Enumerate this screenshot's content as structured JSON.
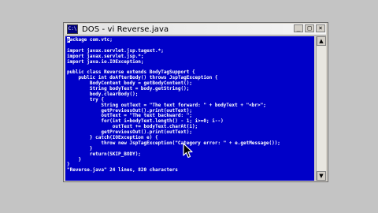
{
  "window": {
    "title": "DOS - vi Reverse.java",
    "icon_text": "C:\\",
    "minimize_label": "_",
    "maximize_label": "□",
    "close_label": "×"
  },
  "editor": {
    "lines": [
      "package com.vtc;",
      "",
      "import javax.servlet.jsp.tagext.*;",
      "import javax.servlet.jsp.*;",
      "import java.io.IOException;",
      "",
      "public class Reverse extends BodyTagSupport {",
      "    public int doAfterBody() throws JspTagException {",
      "        BodyContent body = getBodyContent();",
      "        String bodyText = body.getString();",
      "        body.clearBody();",
      "        try {",
      "            String outText = \"The text forward: \" + bodyText + \"<br>\";",
      "            getPreviousOut().print(outText);",
      "            outText = \"The text backward: \";",
      "            for(int i=bodyText.length() - 1; i>=0; i--)",
      "                outText += bodyText.charAt(i);",
      "            getPreviousOut().print(outText);",
      "        } catch(IOException e) {",
      "            throw new JspTagException(\"Category error: \" + e.getMessage());",
      "        }",
      "        return(SKIP_BODY);",
      "    }",
      "}",
      "\"Reverse.java\" 24 lines, 820 characters"
    ]
  },
  "scrollbar": {
    "up_icon": "▲",
    "down_icon": "▼"
  },
  "icons": {
    "cursor": "mouse-pointer-icon",
    "app": "command-prompt-icon"
  },
  "colors": {
    "console_bg": "#0000c8",
    "console_text": "#ffffff",
    "desktop_bg": "#c4c4c4"
  }
}
